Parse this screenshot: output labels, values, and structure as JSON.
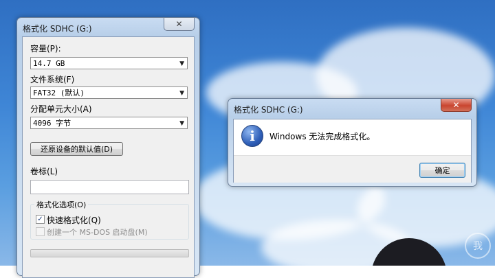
{
  "format_window": {
    "title": "格式化 SDHC (G:)",
    "capacity_label": "容量(P):",
    "capacity_value": "14.7 GB",
    "filesystem_label": "文件系统(F)",
    "filesystem_value": "FAT32 (默认)",
    "alloc_label": "分配单元大小(A)",
    "alloc_value": "4096 字节",
    "restore_defaults_label": "还原设备的默认值(D)",
    "volume_label_label": "卷标(L)",
    "volume_label_value": "",
    "options_title": "格式化选项(O)",
    "quick_format_label": "快速格式化(Q)",
    "quick_format_checked": true,
    "msdos_label": "创建一个 MS-DOS 启动盘(M)",
    "msdos_checked": false
  },
  "message_box": {
    "title": "格式化 SDHC (G:)",
    "message": "Windows 无法完成格式化。",
    "ok_label": "确定"
  },
  "icons": {
    "close": "✕",
    "dropdown": "▼",
    "info": "i",
    "checkmark": "✓"
  },
  "watermark_text": "我"
}
